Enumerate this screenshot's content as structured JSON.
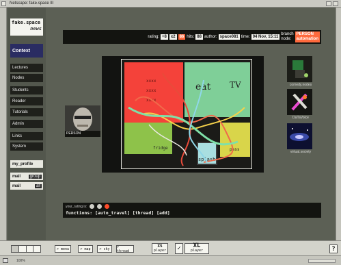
{
  "window": {
    "title": "Netscape: fake.space III"
  },
  "sidebar": {
    "logo_line1": "fake.space",
    "logo_line2": "news",
    "context_label": "Context",
    "items": [
      {
        "label": "Lectures"
      },
      {
        "label": "Nodes"
      },
      {
        "label": "Students"
      },
      {
        "label": "Reader"
      },
      {
        "label": "Tutorials"
      },
      {
        "label": "Admin"
      },
      {
        "label": "Links"
      },
      {
        "label": "System"
      }
    ],
    "my_profile": "my_profile",
    "mail_group": {
      "label": "mail",
      "tag": "group"
    },
    "mail_all": {
      "label": "mail",
      "tag": "all"
    }
  },
  "header": {
    "rating_label": "rating:",
    "rating_value1": "+8",
    "rating_value2": "x2",
    "rating_value3": "86",
    "hits_label": "hits:",
    "hits_value": "88",
    "author_label": "author:",
    "author_value": "space081",
    "time_label": "time:",
    "time_value": "04 Nov, 15:11",
    "branch_label1": "branch",
    "branch_label2": "node:",
    "branch_value1": "PERSON",
    "branch_value2": "automation"
  },
  "map": {
    "labels": {
      "xxxx": "xxxx",
      "eat": "eat",
      "tv": "TV",
      "fridge": "fridge",
      "splash": "splash",
      "pass": "pass"
    },
    "colors": {
      "red": "#f4423a",
      "green": "#7fcf98",
      "lime": "#8ec24a",
      "yellow": "#d9d54a",
      "cyan": "#a9dfe0"
    }
  },
  "portrait": {
    "caption": "PERSON"
  },
  "thumbs": [
    {
      "caption": "comedy.nodes",
      "icon": "robot-icon"
    },
    {
      "caption": "DaTaVoice",
      "icon": "tools-icon"
    },
    {
      "caption": "virtual.society",
      "icon": "galaxy-icon"
    }
  ],
  "functions": {
    "small_label": "your_rating is:",
    "label": "functions:",
    "items": [
      "[auto_travel]",
      "[thread]",
      "[add]"
    ]
  },
  "bottombar": {
    "buttons": [
      "> menu",
      "> map",
      "> sky",
      "> thread"
    ],
    "xs_label": "XS",
    "xs_sub": "player",
    "xl_label": "XL",
    "xl_sub": "player",
    "help": "?"
  },
  "status": {
    "zoom": "100%"
  }
}
